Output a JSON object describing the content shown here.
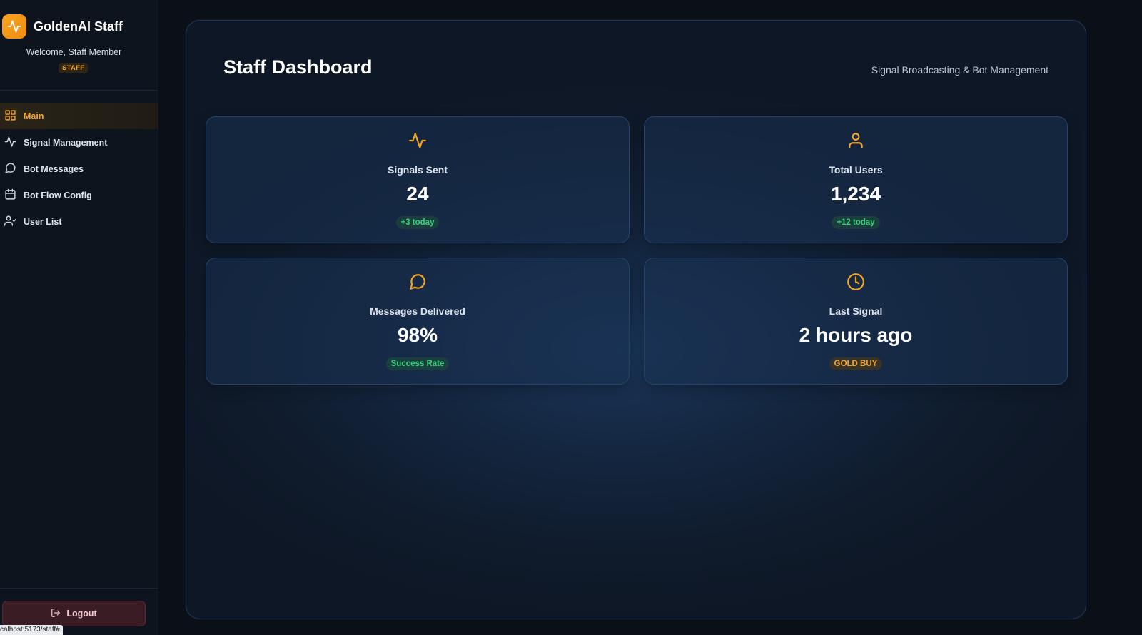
{
  "sidebar": {
    "brand": {
      "title": "GoldenAI Staff",
      "logo_icon": "activity-icon"
    },
    "welcome": "Welcome, Staff Member",
    "role": "STAFF",
    "nav": [
      {
        "label": "Main",
        "icon": "grid-icon",
        "active": true
      },
      {
        "label": "Signal Management",
        "icon": "activity-icon",
        "active": false
      },
      {
        "label": "Bot Messages",
        "icon": "message-circle-icon",
        "active": false
      },
      {
        "label": "Bot Flow Config",
        "icon": "calendar-icon",
        "active": false
      },
      {
        "label": "User List",
        "icon": "user-check-icon",
        "active": false
      }
    ],
    "logout_label": "Logout",
    "status_url": "calhost:5173/staff#"
  },
  "main": {
    "title": "Staff Dashboard",
    "subtitle": "Signal Broadcasting & Bot Management",
    "cards": [
      {
        "label": "Signals Sent",
        "value": "24",
        "badge": "+3 today",
        "icon": "activity-icon",
        "badge_color": "#34d17a"
      },
      {
        "label": "Total Users",
        "value": "1,234",
        "badge": "+12 today",
        "icon": "user-icon",
        "badge_color": "#34d17a"
      },
      {
        "label": "Messages Delivered",
        "value": "98%",
        "badge": "Success Rate",
        "icon": "message-circle-icon",
        "badge_color": "#34d17a"
      },
      {
        "label": "Last Signal",
        "value": "2 hours ago",
        "badge": "GOLD BUY",
        "icon": "clock-icon",
        "badge_color": "#f5a524"
      }
    ]
  },
  "colors": {
    "accent": "#f5a524",
    "success": "#34d17a",
    "background": "#0b0f17",
    "panel": "#13243c"
  }
}
